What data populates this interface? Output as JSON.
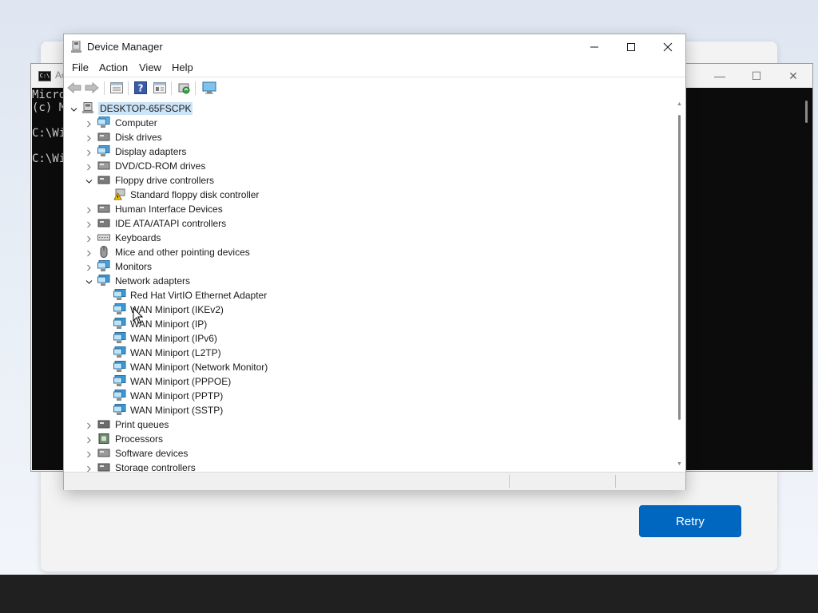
{
  "console": {
    "title": "Ac",
    "lines": [
      "Micro",
      "(c) M",
      "",
      "C:\\Wi",
      "",
      "C:\\Wi"
    ],
    "minimize_icon": "minimize-icon",
    "maximize_icon": "maximize-icon",
    "close_icon": "close-icon"
  },
  "setup": {
    "retry_label": "Retry",
    "accent": "#0067c0"
  },
  "device_manager": {
    "title": "Device Manager",
    "menu": [
      "File",
      "Action",
      "View",
      "Help"
    ],
    "toolbar_icons": [
      "back-arrow-icon",
      "forward-arrow-icon",
      "properties-icon",
      "help-icon",
      "view-icon",
      "update-driver-icon",
      "scan-hardware-icon"
    ],
    "root": "DESKTOP-65FSCPK",
    "categories": [
      {
        "label": "Computer",
        "icon": "computer-icon",
        "expanded": false
      },
      {
        "label": "Disk drives",
        "icon": "disk-drive-icon",
        "expanded": false
      },
      {
        "label": "Display adapters",
        "icon": "display-adapter-icon",
        "expanded": false
      },
      {
        "label": "DVD/CD-ROM drives",
        "icon": "dvd-icon",
        "expanded": false
      },
      {
        "label": "Floppy drive controllers",
        "icon": "floppy-controller-icon",
        "expanded": true,
        "children": [
          {
            "label": "Standard floppy disk controller",
            "icon": "warning-device-icon"
          }
        ]
      },
      {
        "label": "Human Interface Devices",
        "icon": "hid-icon",
        "expanded": false
      },
      {
        "label": "IDE ATA/ATAPI controllers",
        "icon": "ide-controller-icon",
        "expanded": false
      },
      {
        "label": "Keyboards",
        "icon": "keyboard-icon",
        "expanded": false
      },
      {
        "label": "Mice and other pointing devices",
        "icon": "mouse-icon",
        "expanded": false
      },
      {
        "label": "Monitors",
        "icon": "monitor-icon",
        "expanded": false
      },
      {
        "label": "Network adapters",
        "icon": "network-adapter-icon",
        "expanded": true,
        "children": [
          {
            "label": "Red Hat VirtIO Ethernet Adapter",
            "icon": "network-adapter-icon"
          },
          {
            "label": "WAN Miniport (IKEv2)",
            "icon": "network-adapter-icon"
          },
          {
            "label": "WAN Miniport (IP)",
            "icon": "network-adapter-icon"
          },
          {
            "label": "WAN Miniport (IPv6)",
            "icon": "network-adapter-icon"
          },
          {
            "label": "WAN Miniport (L2TP)",
            "icon": "network-adapter-icon"
          },
          {
            "label": "WAN Miniport (Network Monitor)",
            "icon": "network-adapter-icon"
          },
          {
            "label": "WAN Miniport (PPPOE)",
            "icon": "network-adapter-icon"
          },
          {
            "label": "WAN Miniport (PPTP)",
            "icon": "network-adapter-icon"
          },
          {
            "label": "WAN Miniport (SSTP)",
            "icon": "network-adapter-icon"
          }
        ]
      },
      {
        "label": "Print queues",
        "icon": "printer-icon",
        "expanded": false
      },
      {
        "label": "Processors",
        "icon": "processor-icon",
        "expanded": false
      },
      {
        "label": "Software devices",
        "icon": "software-device-icon",
        "expanded": false
      },
      {
        "label": "Storage controllers",
        "icon": "storage-controller-icon",
        "expanded": false
      }
    ]
  }
}
